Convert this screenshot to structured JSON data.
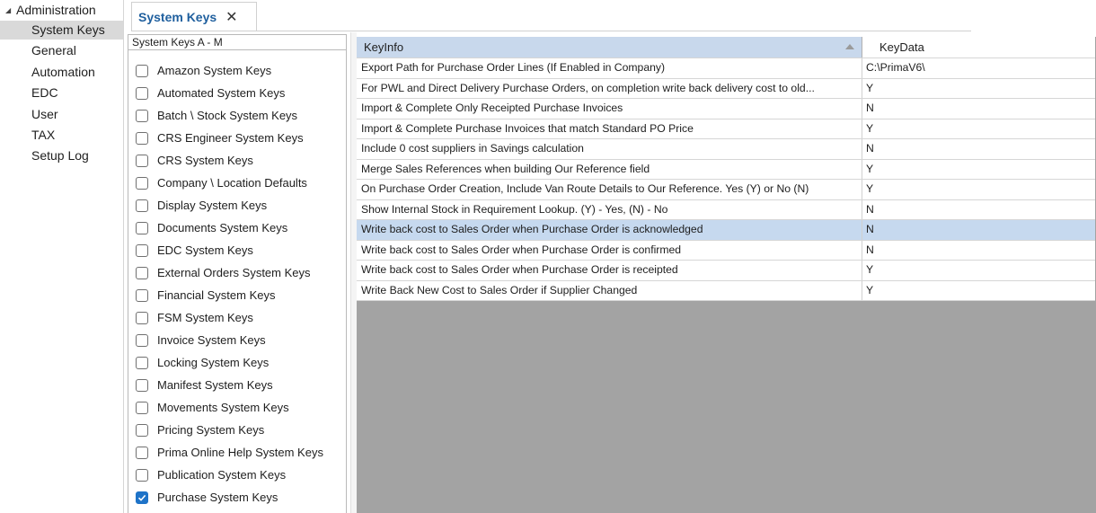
{
  "nav": {
    "root_label": "Administration",
    "items": [
      {
        "label": "System Keys"
      },
      {
        "label": "General"
      },
      {
        "label": "Automation"
      },
      {
        "label": "EDC"
      },
      {
        "label": "User"
      },
      {
        "label": "TAX"
      },
      {
        "label": "Setup Log"
      }
    ],
    "selected_index": 0
  },
  "tab": {
    "label": "System Keys",
    "close_icon": "✕"
  },
  "groups": {
    "header": "System Keys A - M",
    "items": [
      {
        "label": "Amazon System Keys",
        "checked": false
      },
      {
        "label": "Automated System Keys",
        "checked": false
      },
      {
        "label": "Batch \\ Stock System Keys",
        "checked": false
      },
      {
        "label": "CRS Engineer System Keys",
        "checked": false
      },
      {
        "label": "CRS System Keys",
        "checked": false
      },
      {
        "label": "Company \\ Location Defaults",
        "checked": false
      },
      {
        "label": "Display System Keys",
        "checked": false
      },
      {
        "label": "Documents System Keys",
        "checked": false
      },
      {
        "label": "EDC System Keys",
        "checked": false
      },
      {
        "label": "External Orders System Keys",
        "checked": false
      },
      {
        "label": "Financial System Keys",
        "checked": false
      },
      {
        "label": "FSM System Keys",
        "checked": false
      },
      {
        "label": "Invoice System Keys",
        "checked": false
      },
      {
        "label": "Locking System Keys",
        "checked": false
      },
      {
        "label": "Manifest System Keys",
        "checked": false
      },
      {
        "label": "Movements System Keys",
        "checked": false
      },
      {
        "label": "Pricing System Keys",
        "checked": false
      },
      {
        "label": "Prima Online Help System Keys",
        "checked": false
      },
      {
        "label": "Publication System Keys",
        "checked": false
      },
      {
        "label": "Purchase System Keys",
        "checked": true
      }
    ]
  },
  "grid": {
    "columns": {
      "key_info": "KeyInfo",
      "key_data": "KeyData"
    },
    "rows": [
      {
        "info": "Export Path for Purchase Order Lines (If Enabled in Company)",
        "data": "C:\\PrimaV6\\"
      },
      {
        "info": "For PWL and Direct Delivery Purchase Orders, on completion write back delivery cost to old...",
        "data": "Y"
      },
      {
        "info": "Import & Complete Only Receipted Purchase Invoices",
        "data": "N"
      },
      {
        "info": "Import & Complete Purchase Invoices that match Standard PO Price",
        "data": "Y"
      },
      {
        "info": "Include 0 cost suppliers in Savings calculation",
        "data": "N"
      },
      {
        "info": "Merge Sales References when building Our Reference field",
        "data": "Y"
      },
      {
        "info": "On Purchase Order Creation, Include Van Route Details to Our Reference. Yes (Y) or No (N)",
        "data": "Y"
      },
      {
        "info": "Show Internal Stock in Requirement Lookup. (Y) - Yes, (N) - No",
        "data": "N"
      },
      {
        "info": "Write back cost to Sales Order when Purchase Order is acknowledged",
        "data": "N"
      },
      {
        "info": "Write back cost to Sales Order when Purchase Order is confirmed",
        "data": "N"
      },
      {
        "info": "Write back cost to Sales Order when Purchase Order is receipted",
        "data": "Y"
      },
      {
        "info": "Write Back New Cost to Sales Order if Supplier Changed",
        "data": "Y"
      }
    ],
    "selected_row": 8
  },
  "colors": {
    "accent": "#1f5f9e",
    "selection": "#c6d9ef",
    "checkbox_checked": "#1e73c8",
    "grid_background": "#a3a3a3"
  }
}
